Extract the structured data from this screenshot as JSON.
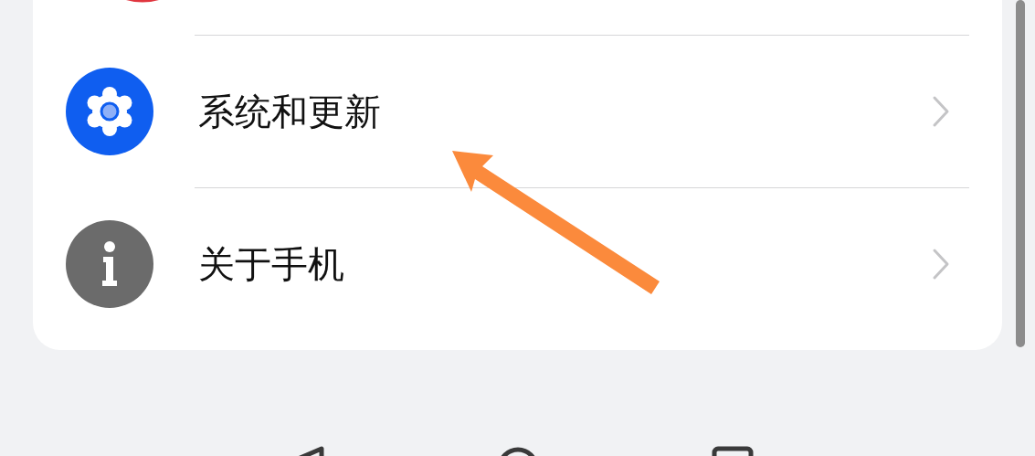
{
  "settings_list": {
    "items": [
      {
        "label": "系统和更新",
        "kind": "gear"
      },
      {
        "label": "关于手机",
        "kind": "info"
      }
    ]
  }
}
